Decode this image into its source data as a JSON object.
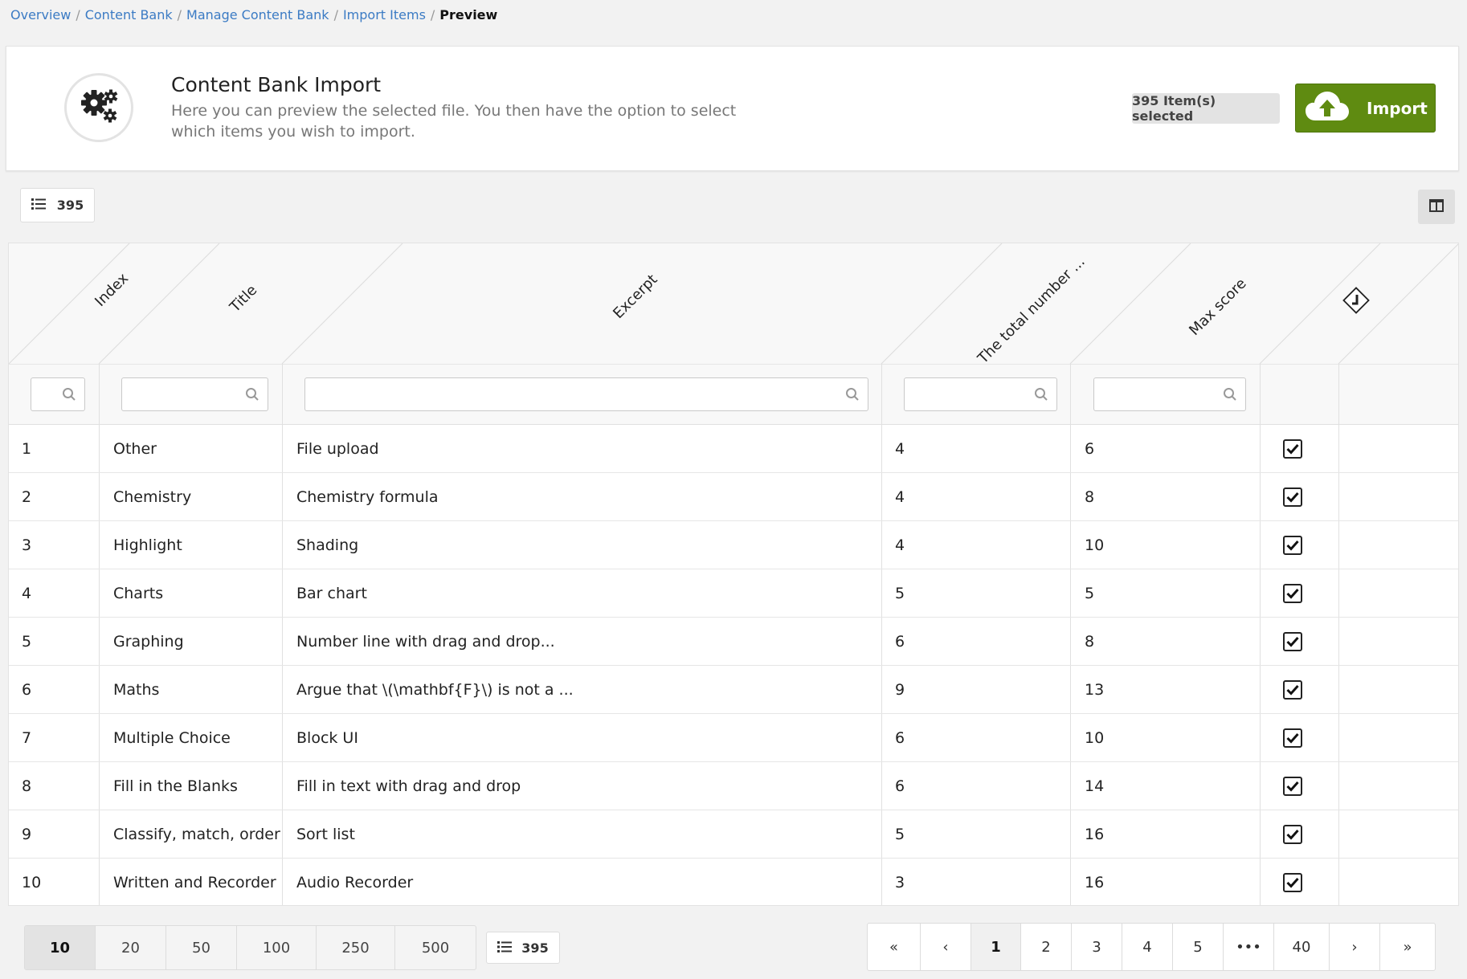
{
  "breadcrumb": {
    "items": [
      "Overview",
      "Content Bank",
      "Manage Content Bank",
      "Import Items"
    ],
    "current": "Preview",
    "separator": "/"
  },
  "header": {
    "title": "Content Bank Import",
    "description": "Here you can preview the selected file. You then have the option to select which items you wish to import.",
    "selected_label": "395 Item(s) selected",
    "import_label": "Import",
    "icon": "gears-icon",
    "accent": "#5f8b11"
  },
  "toolbar": {
    "count": "395",
    "columns_icon": "columns-icon"
  },
  "table": {
    "columns": [
      "Index",
      "Title",
      "Excerpt",
      "The total number ...",
      "Max score"
    ],
    "rows": [
      {
        "index": "1",
        "title": "Other",
        "excerpt": "File upload",
        "total": "4",
        "max": "6",
        "checked": true
      },
      {
        "index": "2",
        "title": "Chemistry",
        "excerpt": "Chemistry formula",
        "total": "4",
        "max": "8",
        "checked": true
      },
      {
        "index": "3",
        "title": "Highlight",
        "excerpt": "Shading",
        "total": "4",
        "max": "10",
        "checked": true
      },
      {
        "index": "4",
        "title": "Charts",
        "excerpt": "Bar chart",
        "total": "5",
        "max": "5",
        "checked": true
      },
      {
        "index": "5",
        "title": "Graphing",
        "excerpt": "Number line with drag and drop...",
        "total": "6",
        "max": "8",
        "checked": true
      },
      {
        "index": "6",
        "title": "Maths",
        "excerpt": "Argue that \\(\\mathbf{F}\\) is not a ...",
        "total": "9",
        "max": "13",
        "checked": true
      },
      {
        "index": "7",
        "title": "Multiple Choice",
        "excerpt": "Block UI",
        "total": "6",
        "max": "10",
        "checked": true
      },
      {
        "index": "8",
        "title": "Fill in the Blanks",
        "excerpt": "Fill in text with drag and drop",
        "total": "6",
        "max": "14",
        "checked": true
      },
      {
        "index": "9",
        "title": "Classify, match, order",
        "excerpt": "Sort list",
        "total": "5",
        "max": "16",
        "checked": true
      },
      {
        "index": "10",
        "title": "Written and Recorder",
        "excerpt": "Audio Recorder",
        "total": "3",
        "max": "16",
        "checked": true
      }
    ]
  },
  "footer": {
    "page_sizes": [
      "10",
      "20",
      "50",
      "100",
      "250",
      "500"
    ],
    "active_page_size": "10",
    "count": "395",
    "pager": [
      "«",
      "‹",
      "1",
      "2",
      "3",
      "4",
      "5",
      "•••",
      "40",
      "›",
      "»"
    ],
    "active_page": "1"
  }
}
